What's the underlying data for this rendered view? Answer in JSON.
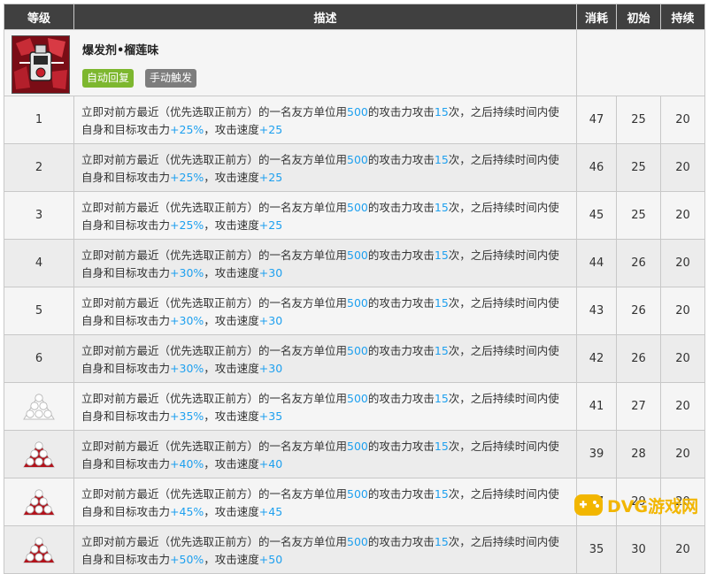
{
  "skill": {
    "name": "爆发剂•榴莲味",
    "tags": [
      "自动回复",
      "手动触发"
    ]
  },
  "columns": [
    "等级",
    "描述",
    "消耗",
    "初始",
    "持续"
  ],
  "rows": [
    {
      "level": "1",
      "seg": [
        "立即对前方最近（优先选取正前方）的一名友方单位用",
        "500",
        "的攻击力攻击",
        "15",
        "次，之后持续时间内使自身和目标攻击力",
        "+25%",
        "，攻击速度",
        "+25"
      ],
      "cost": "47",
      "init": "25",
      "dur": "20"
    },
    {
      "level": "2",
      "seg": [
        "立即对前方最近（优先选取正前方）的一名友方单位用",
        "500",
        "的攻击力攻击",
        "15",
        "次，之后持续时间内使自身和目标攻击力",
        "+25%",
        "，攻击速度",
        "+25"
      ],
      "cost": "46",
      "init": "25",
      "dur": "20"
    },
    {
      "level": "3",
      "seg": [
        "立即对前方最近（优先选取正前方）的一名友方单位用",
        "500",
        "的攻击力攻击",
        "15",
        "次，之后持续时间内使自身和目标攻击力",
        "+25%",
        "，攻击速度",
        "+25"
      ],
      "cost": "45",
      "init": "25",
      "dur": "20"
    },
    {
      "level": "4",
      "seg": [
        "立即对前方最近（优先选取正前方）的一名友方单位用",
        "500",
        "的攻击力攻击",
        "15",
        "次，之后持续时间内使自身和目标攻击力",
        "+30%",
        "，攻击速度",
        "+30"
      ],
      "cost": "44",
      "init": "26",
      "dur": "20"
    },
    {
      "level": "5",
      "seg": [
        "立即对前方最近（优先选取正前方）的一名友方单位用",
        "500",
        "的攻击力攻击",
        "15",
        "次，之后持续时间内使自身和目标攻击力",
        "+30%",
        "，攻击速度",
        "+30"
      ],
      "cost": "43",
      "init": "26",
      "dur": "20"
    },
    {
      "level": "6",
      "seg": [
        "立即对前方最近（优先选取正前方）的一名友方单位用",
        "500",
        "的攻击力攻击",
        "15",
        "次，之后持续时间内使自身和目标攻击力",
        "+30%",
        "，攻击速度",
        "+30"
      ],
      "cost": "42",
      "init": "26",
      "dur": "20"
    },
    {
      "level": "",
      "mastery": 0,
      "seg": [
        "立即对前方最近（优先选取正前方）的一名友方单位用",
        "500",
        "的攻击力攻击",
        "15",
        "次，之后持续时间内使自身和目标攻击力",
        "+35%",
        "，攻击速度",
        "+35"
      ],
      "cost": "41",
      "init": "27",
      "dur": "20"
    },
    {
      "level": "",
      "mastery": 1,
      "seg": [
        "立即对前方最近（优先选取正前方）的一名友方单位用",
        "500",
        "的攻击力攻击",
        "15",
        "次，之后持续时间内使自身和目标攻击力",
        "+40%",
        "，攻击速度",
        "+40"
      ],
      "cost": "39",
      "init": "28",
      "dur": "20"
    },
    {
      "level": "",
      "mastery": 2,
      "seg": [
        "立即对前方最近（优先选取正前方）的一名友方单位用",
        "500",
        "的攻击力攻击",
        "15",
        "次，之后持续时间内使自身和目标攻击力",
        "+45%",
        "，攻击速度",
        "+45"
      ],
      "cost": "37",
      "init": "29",
      "dur": "20"
    },
    {
      "level": "",
      "mastery": 3,
      "seg": [
        "立即对前方最近（优先选取正前方）的一名友方单位用",
        "500",
        "的攻击力攻击",
        "15",
        "次，之后持续时间内使自身和目标攻击力",
        "+50%",
        "，攻击速度",
        "+50"
      ],
      "cost": "35",
      "init": "30",
      "dur": "20"
    }
  ],
  "colors": {
    "highlight": "#1ea0ef",
    "header_bg": "#404040",
    "tag_green": "#7db72f",
    "tag_gray": "#7d7d7d",
    "mastery_red": "#b3121b"
  },
  "watermark": {
    "text": "DVG游戏网"
  }
}
